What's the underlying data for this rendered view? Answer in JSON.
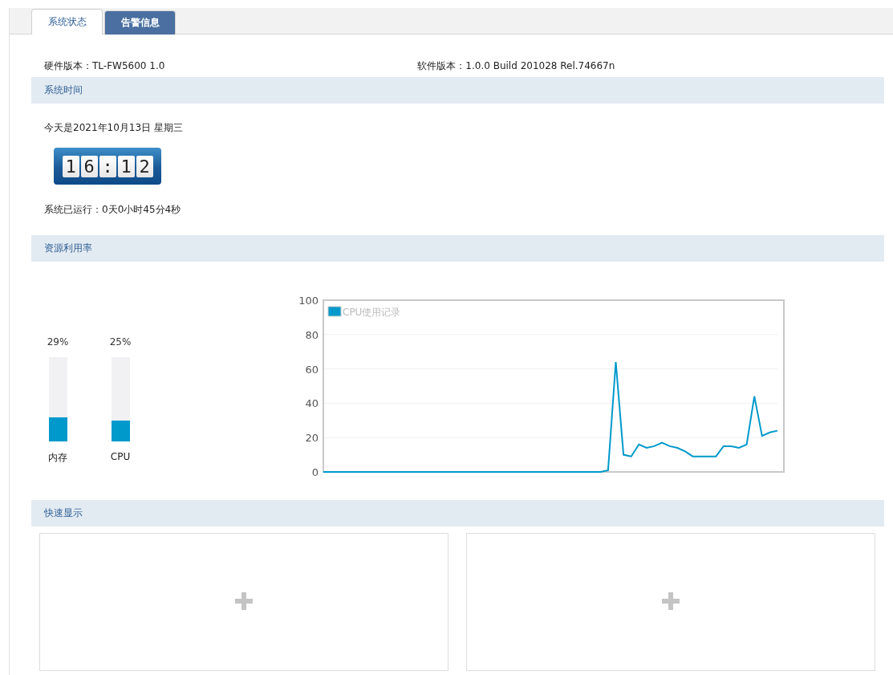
{
  "tabs": [
    {
      "label": "系统状态",
      "selected": true
    },
    {
      "label": "告警信息",
      "selected": false
    }
  ],
  "info": {
    "hardware": "硬件版本：TL-FW5600 1.0",
    "software": "软件版本：1.0.0 Build 201028 Rel.74667n"
  },
  "system_time": {
    "heading": "系统时间",
    "date": "今天是2021年10月13日 星期三",
    "clock": [
      "1",
      "6",
      ":",
      "1",
      "2"
    ],
    "uptime": "系统已运行：0天0小时45分4秒"
  },
  "resources": {
    "heading": "资源利用率",
    "meters": [
      {
        "reading": "29%",
        "level": 0.29,
        "label": "内存"
      },
      {
        "reading": "25%",
        "level": 0.25,
        "label": "CPU"
      }
    ],
    "chart_data": {
      "type": "line",
      "ylim": [
        0,
        100
      ],
      "yticks": [
        0,
        20,
        40,
        60,
        80,
        100
      ],
      "grid": true,
      "series": [
        {
          "name": "CPU使用记录",
          "color": "#0099cc",
          "values": [
            0,
            0,
            0,
            0,
            0,
            0,
            0,
            0,
            0,
            0,
            0,
            0,
            0,
            0,
            0,
            0,
            0,
            0,
            0,
            0,
            0,
            0,
            0,
            0,
            0,
            0,
            0,
            0,
            0,
            0,
            0,
            0,
            0,
            0,
            0,
            0,
            0,
            1,
            64,
            10,
            9,
            16,
            14,
            15,
            17,
            15,
            14,
            12,
            9,
            9,
            9,
            9,
            15,
            15,
            14,
            16,
            44,
            21,
            23,
            24
          ]
        }
      ]
    }
  },
  "quick_display": {
    "heading": "快速显示",
    "cards": [
      {
        "kind": "add"
      },
      {
        "kind": "add"
      }
    ]
  }
}
